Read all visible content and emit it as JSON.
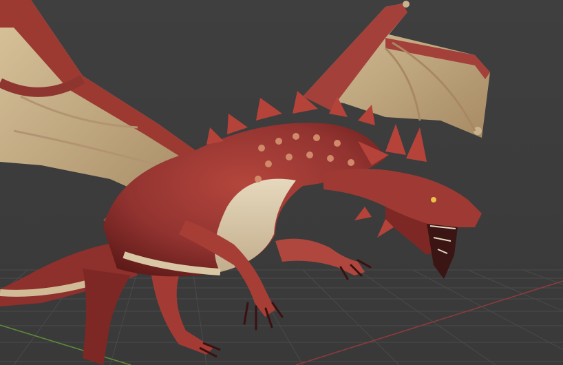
{
  "viewport": {
    "background_color": "#3d3d3d",
    "grid_color": "#4a4a4a",
    "x_axis_color": "#8a3b3f",
    "y_axis_color": "#5d8a3a"
  },
  "model": {
    "subject": "red-dragon",
    "body_color": "#9e3a33",
    "shadow_color": "#5e1a18",
    "belly_color": "#d9c8a8",
    "wing_membrane_color": "#c6ad84",
    "spike_color": "#b5433a"
  }
}
